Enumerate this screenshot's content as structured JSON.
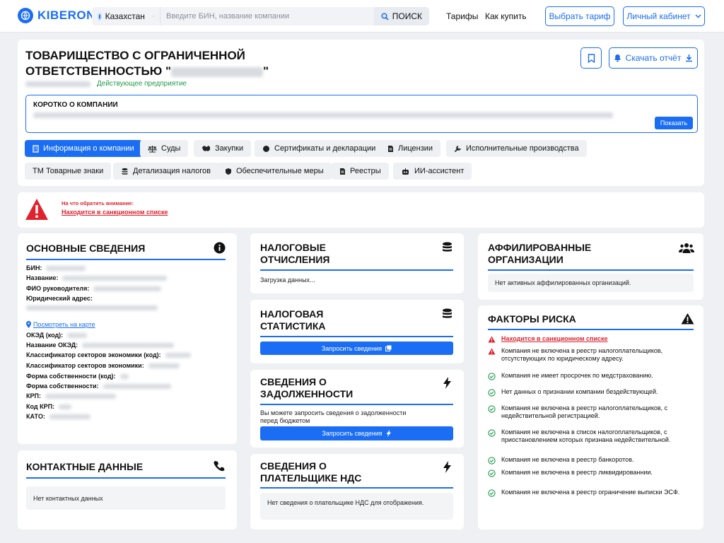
{
  "header": {
    "logo": "KIBERON",
    "country": "Казахстан",
    "search_placeholder": "Введите БИН, название компании",
    "search_button": "ПОИСК",
    "nav": [
      "Тарифы",
      "Как купить"
    ],
    "choose_plan": "Выбрать тариф",
    "cabinet": "Личный кабинет"
  },
  "company": {
    "title_line1": "ТОВАРИЩЕСТВО С ОГРАНИЧЕННОЙ",
    "title_line2_prefix": "ОТВЕТСТВЕННОСТЬЮ \"",
    "title_line2_suffix": "\"",
    "status": "Действующее предприятие",
    "download_report": "Скачать отчёт",
    "about_title": "КОРОТКО О КОМПАНИИ",
    "show_button": "Показать"
  },
  "tabs": {
    "row1": [
      "Информация о компании",
      "Суды",
      "Закупки",
      "Сертификаты и декларации",
      "Лицензии",
      "Исполнительные производства"
    ],
    "row2": [
      "ТМ Товарные знаки",
      "Детализация налогов",
      "Обеспечительные меры",
      "Реестры",
      "ИИ-ассистент"
    ]
  },
  "warning": {
    "title": "На что обратить внимание:",
    "link": "Находится в санкционном списке"
  },
  "basic": {
    "title": "ОСНОВНЫЕ СВЕДЕНИЯ",
    "fields": [
      "БИН:",
      "Название:",
      "ФИО руководителя:",
      "Юридический адрес:"
    ],
    "map_link": "Посмотреть на карте",
    "fields2": [
      "ОКЭД (код):",
      "Название ОКЭД:",
      "Классификатор секторов экономики (код):",
      "Классификатор секторов экономики:",
      "Форма собственности (код):",
      "Форма собственности:",
      "КРП:",
      "Код КРП:",
      "КАТО:"
    ]
  },
  "contacts": {
    "title": "КОНТАКТНЫЕ ДАННЫЕ",
    "empty": "Нет контактных данных"
  },
  "tax_deductions": {
    "title1": "НАЛОГОВЫЕ",
    "title2": "ОТЧИСЛЕНИЯ",
    "loading": "Загрузка данных..."
  },
  "tax_stats": {
    "title1": "НАЛОГОВАЯ",
    "title2": "СТАТИСТИКА",
    "button": "Запросить сведения"
  },
  "debt": {
    "title1": "СВЕДЕНИЯ О",
    "title2": "ЗАДОЛЖЕННОСТИ",
    "text": "Вы можете запросить сведения о задолженности перед бюджетом",
    "button": "Запросить сведения"
  },
  "vat": {
    "title1": "СВЕДЕНИЯ О",
    "title2": "ПЛАТЕЛЬЩИКЕ НДС",
    "text": "Нет сведения о плательщике НДС для отображения."
  },
  "affiliated": {
    "title1": "АФФИЛИРОВАННЫЕ",
    "title2": "ОРГАНИЗАЦИИ",
    "empty": "Нет активных аффилированных организаций."
  },
  "risks": {
    "title": "ФАКТОРЫ РИСКА",
    "items": [
      {
        "text": "Находится в санкционном списке",
        "level": "red"
      },
      {
        "text": "Компания не включена в реестр налогоплательщиков, отсутствующих по юридическому адресу.",
        "level": "warn"
      },
      {
        "text": "Компания не имеет просрочек по медстрахованию.",
        "level": "ok"
      },
      {
        "text": "Нет данных о признании компании бездействующей.",
        "level": "ok"
      },
      {
        "text": "Компания не включена в реестр налогоплательщиков, с недействительной регистрацией.",
        "level": "ok"
      },
      {
        "text": "Компания не включена в список налогоплательщиков, с приостановлением которых признана недействительной.",
        "level": "ok"
      },
      {
        "text": "Компания не включена в реестр банкоротов.",
        "level": "ok"
      },
      {
        "text": "Компания не включена в реестр ликвидированнии.",
        "level": "ok"
      },
      {
        "text": "Компания не включена в реестр ограничение выписки ЭСФ.",
        "level": "ok"
      }
    ]
  },
  "colors": {
    "accent": "#1b6ef3",
    "danger": "#e0212e",
    "success": "#1f9a4a"
  }
}
